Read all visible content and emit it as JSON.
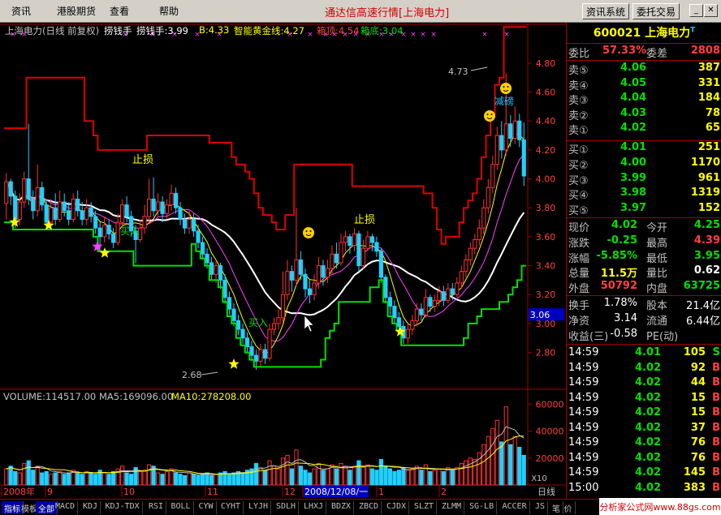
{
  "menu": {
    "items": [
      "资讯",
      "港股期货",
      "查看",
      "帮助"
    ],
    "title": "通达信高速行情[上海电力]",
    "btn_news": "资讯系统",
    "btn_trade": "委托交易"
  },
  "infobar": {
    "stock": "上海电力(日线 前复权)",
    "indicator": "捞钱手",
    "lqs": "捞钱手:3.99",
    "b": "B:4.33",
    "zngold": "智能黄金线:4.27",
    "boxtop": "箱顶:4.54",
    "boxbot": "箱底:3.04"
  },
  "annotations": {
    "stoploss1": "止损",
    "stoploss2": "止损",
    "buy1": "买入",
    "buy2": "买入",
    "reduce": "减磅",
    "high": "4.73",
    "low": "2.68"
  },
  "price_axis": {
    "ticks": [
      "4.80",
      "4.60",
      "4.40",
      "4.20",
      "4.00",
      "3.80",
      "3.60",
      "3.40",
      "3.20",
      "3.00",
      "2.80"
    ],
    "current_label": "3.06"
  },
  "volume_bar": {
    "volume": "VOLUME:114517.00",
    "ma5": "MA5:169096.00",
    "ma10": "MA10:278208.00",
    "ticks": [
      "60000",
      "40000",
      "20000"
    ],
    "unit": "X10"
  },
  "date_axis": {
    "labels": [
      "2008年",
      "9",
      "10",
      "11",
      "12",
      "2008/12/08/一",
      "1",
      "2"
    ],
    "period": "日线"
  },
  "quote": {
    "code": "600021",
    "name": "上海电力",
    "sup": "T",
    "ratio_label": "委比",
    "ratio": "57.33%",
    "diff_label": "委差",
    "diff": "2808",
    "asks": [
      {
        "label": "卖⑤",
        "price": "4.06",
        "vol": "387"
      },
      {
        "label": "卖④",
        "price": "4.05",
        "vol": "331"
      },
      {
        "label": "卖③",
        "price": "4.04",
        "vol": "184"
      },
      {
        "label": "卖②",
        "price": "4.03",
        "vol": "78"
      },
      {
        "label": "卖①",
        "price": "4.02",
        "vol": "65"
      }
    ],
    "bids": [
      {
        "label": "买①",
        "price": "4.01",
        "vol": "251"
      },
      {
        "label": "买②",
        "price": "4.00",
        "vol": "1170"
      },
      {
        "label": "买③",
        "price": "3.99",
        "vol": "961"
      },
      {
        "label": "买④",
        "price": "3.98",
        "vol": "1319"
      },
      {
        "label": "买⑤",
        "price": "3.97",
        "vol": "152"
      }
    ],
    "stats": [
      {
        "l1": "现价",
        "v1": "4.02",
        "l2": "今开",
        "v2": "4.25",
        "c1": "#00e000",
        "c2": "#00e000"
      },
      {
        "l1": "涨跌",
        "v1": "-0.25",
        "l2": "最高",
        "v2": "4.39",
        "c1": "#00e000",
        "c2": "#ff4040"
      },
      {
        "l1": "涨幅",
        "v1": "-5.85%",
        "l2": "最低",
        "v2": "3.95",
        "c1": "#00e000",
        "c2": "#00e000"
      },
      {
        "l1": "总量",
        "v1": "11.5万",
        "l2": "量比",
        "v2": "0.62",
        "c1": "#ffff00",
        "c2": "#ffffff"
      },
      {
        "l1": "外盘",
        "v1": "50792",
        "l2": "内盘",
        "v2": "63725",
        "c1": "#ff4040",
        "c2": "#00e000"
      }
    ],
    "stats2": [
      {
        "l1": "换手",
        "v1": "1.78%",
        "l2": "股本",
        "v2": "21.4亿"
      },
      {
        "l1": "净资",
        "v1": "3.14",
        "l2": "流通",
        "v2": "6.44亿"
      },
      {
        "l1": "收益(三)",
        "v1": "-0.58",
        "l2": "PE(动)",
        "v2": ""
      }
    ],
    "ticks": [
      {
        "time": "14:59",
        "price": "4.01",
        "vol": "105",
        "dir": "S"
      },
      {
        "time": "14:59",
        "price": "4.02",
        "vol": "92",
        "dir": "B"
      },
      {
        "time": "14:59",
        "price": "4.02",
        "vol": "44",
        "dir": "B"
      },
      {
        "time": "14:59",
        "price": "4.02",
        "vol": "15",
        "dir": "B"
      },
      {
        "time": "14:59",
        "price": "4.02",
        "vol": "15",
        "dir": "B"
      },
      {
        "time": "14:59",
        "price": "4.02",
        "vol": "37",
        "dir": "B"
      },
      {
        "time": "14:59",
        "price": "4.02",
        "vol": "76",
        "dir": "B"
      },
      {
        "time": "14:59",
        "price": "4.02",
        "vol": "76",
        "dir": "B"
      },
      {
        "time": "14:59",
        "price": "4.02",
        "vol": "145",
        "dir": "B"
      },
      {
        "time": "15:00",
        "price": "4.02",
        "vol": "383",
        "dir": "B"
      }
    ]
  },
  "tabs": [
    "指标",
    "模板",
    "全部",
    "MACD",
    "KDJ",
    "KDJ-TDX",
    "RSI",
    "BOLL",
    "CYW",
    "CYHT",
    "LYJH",
    "SDLH",
    "LHXJ",
    "BDZX",
    "ZBCD",
    "CJDX",
    "SLZT",
    "ZLMM",
    "SG-LB",
    "ACCER",
    "JS",
    "笔",
    "价"
  ],
  "watermark": "分析家公式网www.88gs.com",
  "chart_data": {
    "type": "candlestick",
    "ylim": [
      2.68,
      4.9
    ],
    "candles": [
      [
        3.83,
        3.98,
        4.04,
        3.72
      ],
      [
        3.98,
        3.88,
        4.0,
        3.82
      ],
      [
        3.88,
        3.72,
        3.92,
        3.66
      ],
      [
        3.72,
        3.84,
        3.9,
        3.68
      ],
      [
        3.84,
        4.0,
        4.05,
        3.8
      ],
      [
        4.0,
        3.86,
        4.38,
        3.82
      ],
      [
        3.86,
        3.78,
        3.92,
        3.72
      ],
      [
        3.78,
        3.94,
        4.1,
        3.74
      ],
      [
        3.94,
        3.82,
        3.98,
        3.78
      ],
      [
        3.82,
        3.7,
        3.86,
        3.66
      ],
      [
        3.7,
        3.8,
        3.86,
        3.66
      ],
      [
        3.8,
        3.72,
        3.9,
        3.68
      ],
      [
        3.72,
        3.84,
        3.92,
        3.7
      ],
      [
        3.84,
        3.78,
        3.9,
        3.74
      ],
      [
        3.78,
        3.72,
        3.84,
        3.68
      ],
      [
        3.72,
        3.86,
        3.9,
        3.7
      ],
      [
        3.86,
        3.78,
        3.92,
        3.74
      ],
      [
        3.78,
        3.72,
        3.84,
        3.68
      ],
      [
        3.72,
        3.8,
        3.86,
        3.68
      ],
      [
        3.8,
        3.74,
        3.84,
        3.7
      ],
      [
        3.74,
        3.66,
        3.78,
        3.62
      ],
      [
        3.66,
        3.6,
        3.7,
        3.52
      ],
      [
        3.6,
        3.68,
        3.74,
        3.56
      ],
      [
        3.68,
        3.62,
        3.72,
        3.58
      ],
      [
        3.62,
        3.56,
        3.66,
        3.52
      ],
      [
        3.56,
        3.7,
        3.76,
        3.54
      ],
      [
        3.7,
        3.82,
        3.86,
        3.66
      ],
      [
        3.82,
        3.74,
        3.88,
        3.7
      ],
      [
        3.74,
        3.64,
        3.78,
        3.6
      ],
      [
        3.64,
        3.58,
        3.68,
        3.42
      ],
      [
        3.58,
        3.66,
        3.72,
        3.56
      ],
      [
        3.66,
        3.74,
        3.82,
        3.62
      ],
      [
        3.74,
        3.86,
        4.0,
        3.7
      ],
      [
        3.86,
        3.78,
        4.01,
        3.74
      ],
      [
        3.78,
        3.84,
        3.9,
        3.74
      ],
      [
        3.84,
        3.76,
        3.88,
        3.7
      ],
      [
        3.76,
        3.82,
        3.86,
        3.72
      ],
      [
        3.82,
        3.9,
        3.96,
        3.78
      ],
      [
        3.9,
        3.8,
        3.94,
        3.76
      ],
      [
        3.8,
        3.72,
        3.84,
        3.68
      ],
      [
        3.72,
        3.66,
        3.76,
        3.62
      ],
      [
        3.66,
        3.72,
        3.78,
        3.62
      ],
      [
        3.72,
        3.64,
        3.76,
        3.6
      ],
      [
        3.64,
        3.56,
        3.68,
        3.52
      ],
      [
        3.56,
        3.48,
        3.6,
        3.44
      ],
      [
        3.48,
        3.42,
        3.52,
        3.38
      ],
      [
        3.42,
        3.34,
        3.46,
        3.3
      ],
      [
        3.34,
        3.4,
        3.44,
        3.28
      ],
      [
        3.4,
        3.3,
        3.42,
        3.24
      ],
      [
        3.3,
        3.18,
        3.34,
        3.14
      ],
      [
        3.18,
        3.1,
        3.22,
        3.06
      ],
      [
        3.1,
        3.02,
        3.14,
        2.98
      ],
      [
        3.02,
        2.96,
        3.06,
        2.92
      ],
      [
        2.96,
        2.9,
        3.0,
        2.86
      ],
      [
        2.9,
        2.84,
        2.94,
        2.8
      ],
      [
        2.84,
        2.78,
        2.88,
        2.74
      ],
      [
        2.78,
        2.74,
        2.82,
        2.68
      ],
      [
        2.74,
        2.82,
        2.86,
        2.7
      ],
      [
        2.82,
        2.76,
        2.86,
        2.72
      ],
      [
        2.76,
        2.96,
        3.0,
        2.74
      ],
      [
        2.96,
        3.0,
        3.04,
        2.92
      ],
      [
        3.0,
        3.04,
        3.1,
        2.96
      ],
      [
        3.04,
        3.2,
        3.36,
        3.0
      ],
      [
        3.2,
        3.36,
        3.44,
        3.16
      ],
      [
        3.36,
        3.3,
        3.4,
        3.22
      ],
      [
        3.3,
        3.44,
        3.8,
        3.26
      ],
      [
        3.44,
        3.34,
        3.5,
        3.3
      ],
      [
        3.34,
        3.24,
        3.38,
        3.18
      ],
      [
        3.24,
        3.2,
        3.3,
        3.14
      ],
      [
        3.2,
        3.28,
        3.34,
        3.16
      ],
      [
        3.28,
        3.4,
        3.46,
        3.24
      ],
      [
        3.4,
        3.32,
        3.44,
        3.26
      ],
      [
        3.32,
        3.38,
        3.44,
        3.28
      ],
      [
        3.38,
        3.48,
        3.54,
        3.34
      ],
      [
        3.48,
        3.42,
        3.56,
        3.38
      ],
      [
        3.42,
        3.56,
        3.62,
        3.4
      ],
      [
        3.56,
        3.6,
        3.64,
        3.5
      ],
      [
        3.6,
        3.54,
        3.62,
        3.48
      ],
      [
        3.54,
        3.62,
        3.66,
        3.5
      ],
      [
        3.62,
        3.4,
        3.64,
        3.36
      ],
      [
        3.4,
        3.52,
        3.58,
        3.38
      ],
      [
        3.52,
        3.6,
        3.64,
        3.5
      ],
      [
        3.6,
        3.56,
        3.62,
        3.5
      ],
      [
        3.56,
        3.5,
        3.6,
        3.46
      ],
      [
        3.5,
        3.32,
        3.52,
        3.28
      ],
      [
        3.32,
        3.18,
        3.34,
        3.14
      ],
      [
        3.18,
        3.12,
        3.22,
        3.06
      ],
      [
        3.12,
        3.04,
        3.16,
        3.0
      ],
      [
        3.04,
        2.98,
        3.08,
        2.94
      ],
      [
        2.98,
        2.9,
        3.02,
        2.86
      ],
      [
        2.9,
        2.96,
        3.0,
        2.86
      ],
      [
        2.96,
        3.02,
        3.06,
        2.92
      ],
      [
        3.02,
        3.1,
        3.14,
        2.98
      ],
      [
        3.1,
        3.06,
        3.14,
        3.02
      ],
      [
        3.06,
        3.18,
        3.24,
        3.04
      ],
      [
        3.18,
        3.12,
        3.2,
        3.08
      ],
      [
        3.12,
        3.16,
        3.2,
        3.08
      ],
      [
        3.16,
        3.22,
        3.26,
        3.12
      ],
      [
        3.22,
        3.16,
        3.26,
        3.12
      ],
      [
        3.16,
        3.24,
        3.28,
        3.14
      ],
      [
        3.24,
        3.2,
        3.28,
        3.16
      ],
      [
        3.2,
        3.28,
        3.32,
        3.18
      ],
      [
        3.28,
        3.36,
        3.4,
        3.24
      ],
      [
        3.36,
        3.44,
        3.48,
        3.32
      ],
      [
        3.44,
        3.52,
        3.56,
        3.4
      ],
      [
        3.52,
        3.58,
        3.62,
        3.48
      ],
      [
        3.58,
        3.66,
        3.72,
        3.54
      ],
      [
        3.66,
        3.8,
        3.86,
        3.62
      ],
      [
        3.8,
        3.94,
        4.0,
        3.76
      ],
      [
        3.94,
        4.1,
        4.16,
        3.9
      ],
      [
        4.1,
        4.3,
        4.36,
        4.06
      ],
      [
        4.3,
        4.2,
        4.4,
        4.14
      ],
      [
        4.2,
        4.38,
        4.73,
        4.16
      ],
      [
        4.38,
        4.28,
        4.44,
        4.22
      ],
      [
        4.28,
        4.4,
        4.5,
        4.24
      ],
      [
        4.4,
        4.27,
        4.45,
        4.22
      ],
      [
        4.27,
        4.02,
        4.39,
        3.95
      ]
    ],
    "volume": [
      12,
      14,
      10,
      9,
      16,
      18,
      11,
      14,
      9,
      10,
      8,
      9,
      10,
      8,
      9,
      11,
      9,
      8,
      10,
      9,
      8,
      11,
      9,
      8,
      10,
      12,
      14,
      9,
      8,
      13,
      10,
      11,
      15,
      14,
      9,
      8,
      10,
      12,
      9,
      8,
      7,
      9,
      8,
      7,
      8,
      9,
      7,
      8,
      9,
      10,
      8,
      9,
      10,
      9,
      11,
      12,
      16,
      13,
      11,
      18,
      14,
      12,
      20,
      22,
      12,
      26,
      14,
      11,
      9,
      12,
      16,
      11,
      12,
      15,
      12,
      16,
      14,
      11,
      14,
      18,
      13,
      15,
      12,
      11,
      19,
      14,
      12,
      10,
      11,
      13,
      11,
      12,
      14,
      11,
      15,
      10,
      11,
      12,
      10,
      13,
      11,
      13,
      16,
      18,
      20,
      19,
      24,
      30,
      36,
      42,
      48,
      32,
      58,
      30,
      36,
      28,
      22
    ]
  }
}
